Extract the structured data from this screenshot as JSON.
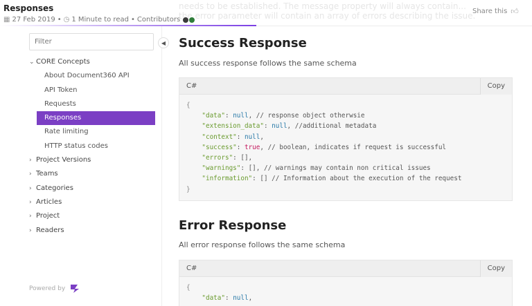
{
  "header": {
    "title": "Responses",
    "date": "27 Feb 2019",
    "read_time": "1 Minute to read",
    "contributors_label": "Contributors",
    "faded_text_1": "needs to be established. The message property will always contain...",
    "faded_text_2": "the error parameter will contain an array of errors describing the issue.",
    "share_label": "Share this",
    "colors": {
      "progress": "#7b3fe4"
    }
  },
  "sidebar": {
    "filter_placeholder": "Filter",
    "items": [
      {
        "label": "CORE Concepts",
        "caret": "⌄",
        "level": 0,
        "expanded": true
      },
      {
        "label": "About Document360 API",
        "level": 1
      },
      {
        "label": "API Token",
        "level": 1
      },
      {
        "label": "Requests",
        "level": 1
      },
      {
        "label": "Responses",
        "level": 1,
        "active": true
      },
      {
        "label": "Rate limiting",
        "level": 1
      },
      {
        "label": "HTTP status codes",
        "level": 1
      },
      {
        "label": "Project Versions",
        "caret": "›",
        "level": 0
      },
      {
        "label": "Teams",
        "caret": "›",
        "level": 0
      },
      {
        "label": "Categories",
        "caret": "›",
        "level": 0
      },
      {
        "label": "Articles",
        "caret": "›",
        "level": 0
      },
      {
        "label": "Project",
        "caret": "›",
        "level": 0
      },
      {
        "label": "Readers",
        "caret": "›",
        "level": 0
      }
    ],
    "powered_by": "Powered by",
    "active_color": "#7b3fc4"
  },
  "content": {
    "success": {
      "title": "Success Response",
      "description": "All success response follows the same schema",
      "code_lang": "C#",
      "copy_label": "Copy"
    },
    "error": {
      "title": "Error Response",
      "description": "All error response follows the same schema",
      "code_lang": "C#",
      "copy_label": "Copy"
    }
  }
}
